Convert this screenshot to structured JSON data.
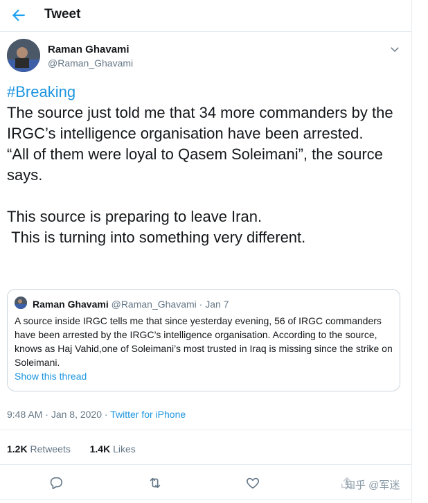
{
  "header": {
    "title": "Tweet",
    "back_icon": "arrow-left-icon"
  },
  "author": {
    "name": "Raman Ghavami",
    "handle": "@Raman_Ghavami"
  },
  "tweet": {
    "hashtag": "#Breaking",
    "body": "The source just told me that 34 more commanders by the IRGC’s intelligence organisation have been arrested.\n“All of them were loyal to Qasem Soleimani”, the source says.\n\nThis source is preparing to leave Iran.\n This is turning into something very different."
  },
  "quote": {
    "name": "Raman Ghavami",
    "handle": "@Raman_Ghavami",
    "date": "Jan 7",
    "text": "A source inside IRGC tells me that since yesterday evening, 56 of IRGC commanders have been arrested by the IRGC’s intelligence organisation. According to the source, knows as Haj Vahid,one of Soleimani’s most trusted in Iraq is missing since the strike on Soleimani.",
    "link": "Show this thread"
  },
  "meta": {
    "time": "9:48 AM",
    "date": "Jan 8, 2020",
    "source": "Twitter for iPhone"
  },
  "stats": {
    "retweets_count": "1.2K",
    "retweets_label": "Retweets",
    "likes_count": "1.4K",
    "likes_label": "Likes"
  },
  "actions": [
    "reply-icon",
    "retweet-icon",
    "like-icon",
    "share-icon"
  ],
  "watermark": "知乎 @军迷",
  "colors": {
    "accent": "#1da1f2",
    "link": "#1b95e0",
    "text": "#14171a",
    "secondary": "#657786",
    "border": "#e6ecf0"
  }
}
